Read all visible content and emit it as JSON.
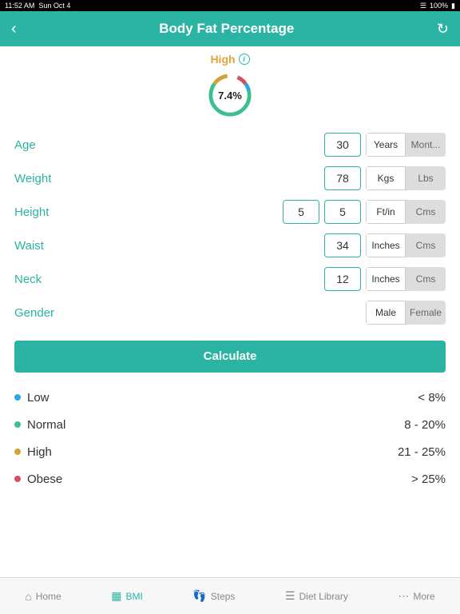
{
  "status": {
    "time": "11:52 AM",
    "date": "Sun Oct 4",
    "battery": "100%"
  },
  "header": {
    "title": "Body Fat Percentage"
  },
  "result": {
    "label": "High",
    "value": "7.4%"
  },
  "fields": {
    "age": {
      "label": "Age",
      "value": "30",
      "unit_a": "Years",
      "unit_b": "Mont...",
      "active": "a"
    },
    "weight": {
      "label": "Weight",
      "value": "78",
      "unit_a": "Kgs",
      "unit_b": "Lbs",
      "active": "a"
    },
    "height": {
      "label": "Height",
      "value1": "5",
      "value2": "5",
      "unit_a": "Ft/in",
      "unit_b": "Cms",
      "active": "a"
    },
    "waist": {
      "label": "Waist",
      "value": "34",
      "unit_a": "Inches",
      "unit_b": "Cms",
      "active": "a"
    },
    "neck": {
      "label": "Neck",
      "value": "12",
      "unit_a": "Inches",
      "unit_b": "Cms",
      "active": "a"
    },
    "gender": {
      "label": "Gender",
      "unit_a": "Male",
      "unit_b": "Female",
      "active": "a"
    }
  },
  "calculate": "Calculate",
  "legend": [
    {
      "name": "Low",
      "range": "< 8%",
      "color": "#2aa7e0"
    },
    {
      "name": "Normal",
      "range": "8 - 20%",
      "color": "#3cc18e"
    },
    {
      "name": "High",
      "range": "21 - 25%",
      "color": "#d1a234"
    },
    {
      "name": "Obese",
      "range": "> 25%",
      "color": "#d45060"
    }
  ],
  "tabs": {
    "home": "Home",
    "bmi": "BMI",
    "steps": "Steps",
    "diet": "Diet Library",
    "more": "More"
  }
}
